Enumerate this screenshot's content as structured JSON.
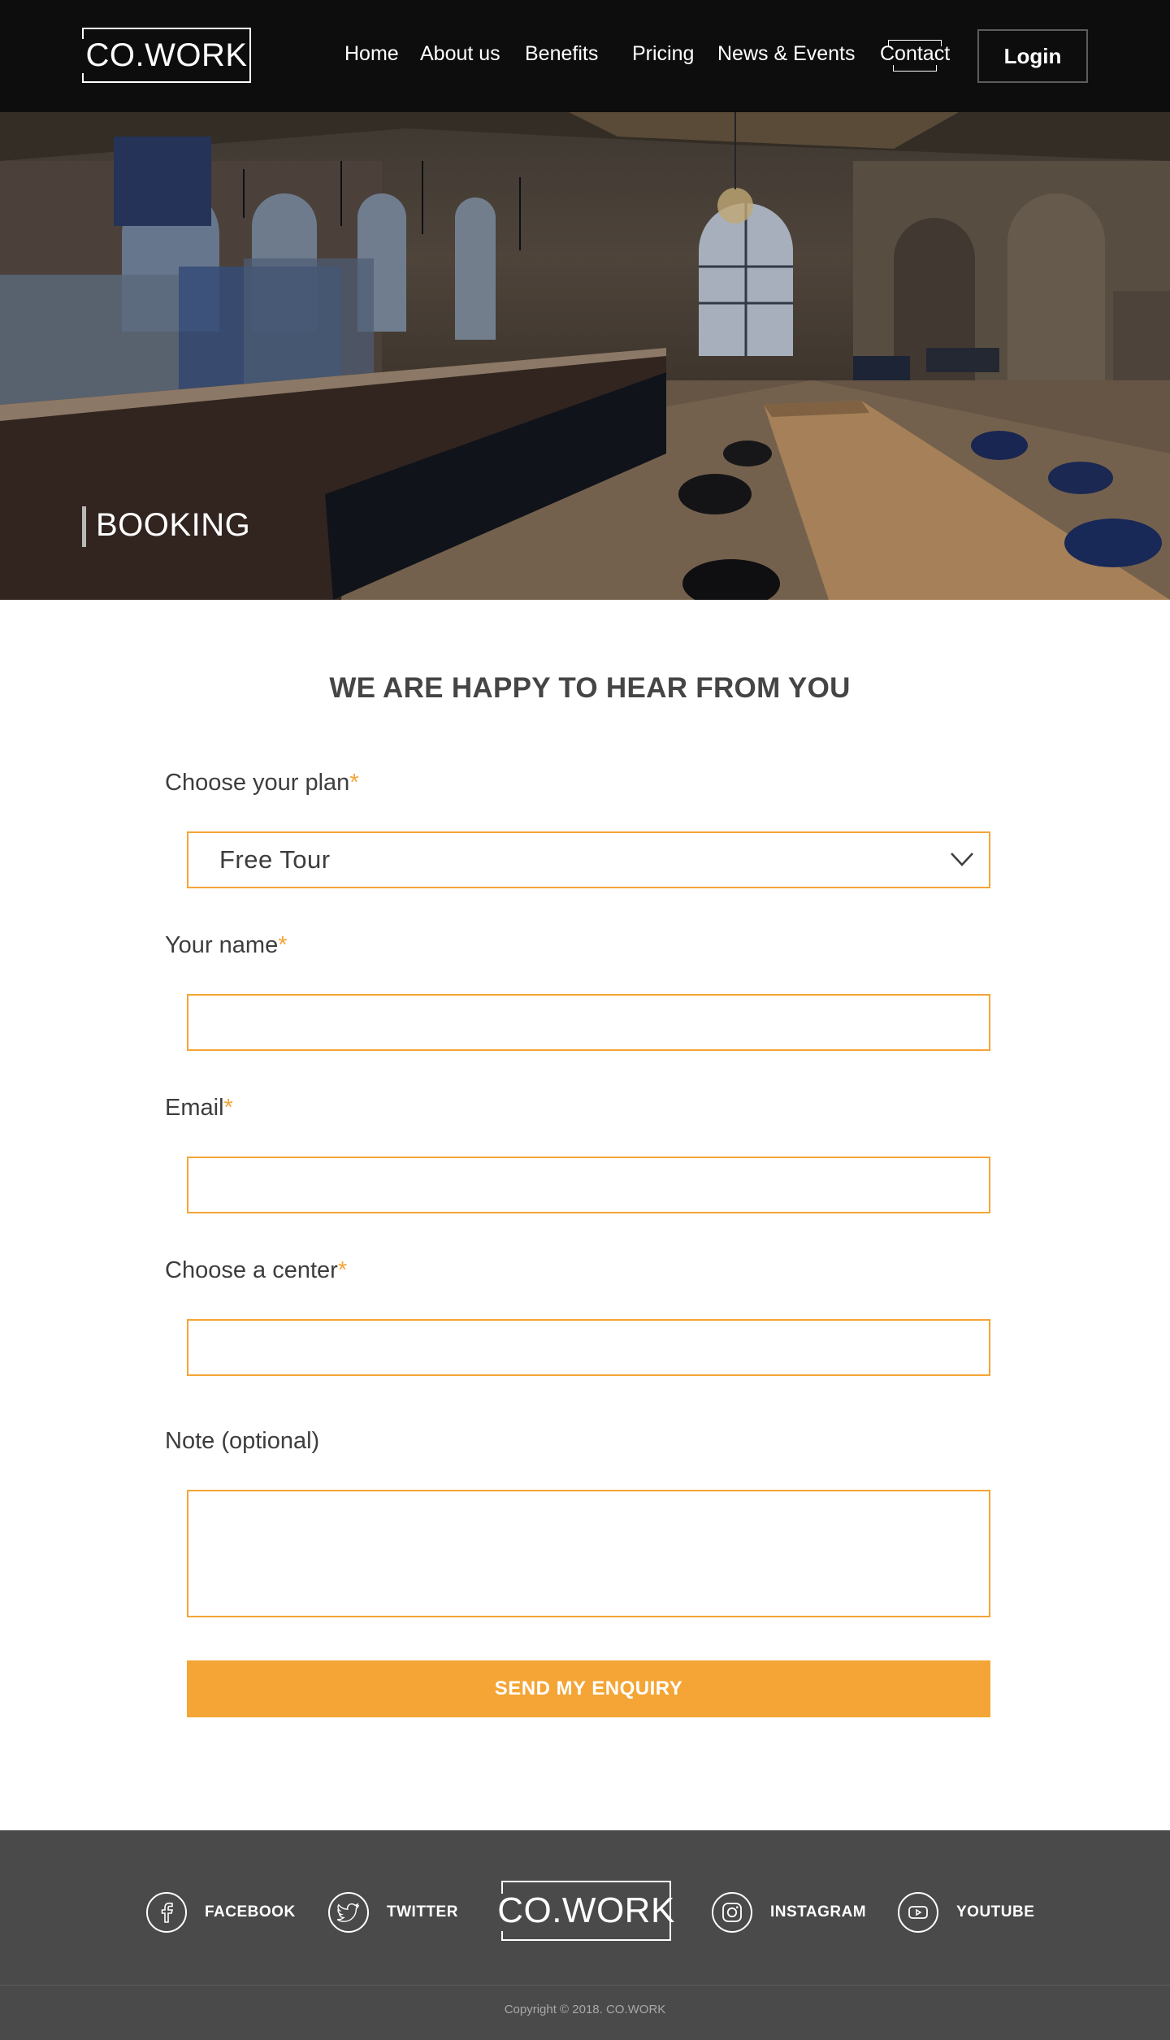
{
  "header": {
    "logo_text": "CO.WORK",
    "nav": [
      "Home",
      "About us",
      "Benefits",
      "Pricing",
      "News & Events",
      "Contact"
    ],
    "login_label": "Login"
  },
  "hero": {
    "title": "BOOKING"
  },
  "form": {
    "title": "WE ARE HAPPY TO HEAR FROM YOU",
    "required_mark": "*",
    "plan": {
      "label": "Choose your plan",
      "value": "Free Tour"
    },
    "name": {
      "label": "Your name",
      "value": ""
    },
    "email": {
      "label": "Email",
      "value": ""
    },
    "center": {
      "label": "Choose a center",
      "value": ""
    },
    "note": {
      "label": "Note (optional)",
      "value": ""
    },
    "submit_label": "SEND MY ENQUIRY"
  },
  "footer": {
    "logo_text": "CO.WORK",
    "social": [
      {
        "label": "FACEBOOK",
        "icon": "facebook-icon"
      },
      {
        "label": "TWITTER",
        "icon": "twitter-icon"
      },
      {
        "label": "INSTAGRAM",
        "icon": "instagram-icon"
      },
      {
        "label": "YOUTUBE",
        "icon": "youtube-icon"
      }
    ],
    "copyright": "Copyright © 2018. CO.WORK"
  },
  "colors": {
    "accent": "#f4a535",
    "header_bg": "#0d0d0d",
    "footer_bg": "#4a4a4a",
    "text": "#3d3d3d"
  }
}
